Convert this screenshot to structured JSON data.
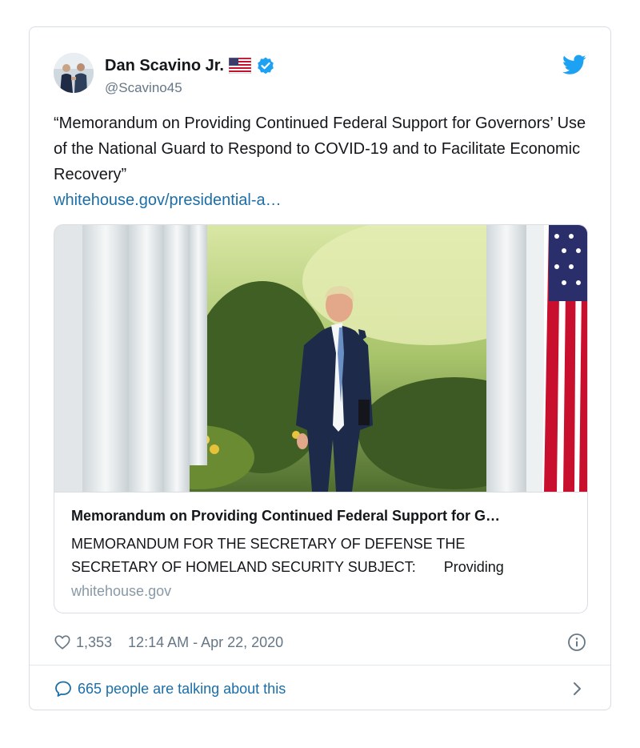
{
  "author": {
    "name": "Dan Scavino Jr.",
    "handle": "@Scavino45",
    "flag_icon": "us-flag-emoji",
    "verified_icon": "verified-badge-icon"
  },
  "tweet": {
    "text": "“Memorandum on Providing Continued Federal Support for Governors’ Use of the National Guard to Respond to COVID-19 and to Facilitate Economic Recovery”",
    "link": "whitehouse.gov/presidential-a…"
  },
  "link_card": {
    "title": "Memorandum on Providing Continued Federal Support for G…",
    "description": "MEMORANDUM FOR THE SECRETARY OF DEFENSE THE\nSECRETARY OF HOMELAND SECURITY SUBJECT:       Providing",
    "domain": "whitehouse.gov"
  },
  "stats": {
    "likes": "1,353",
    "timestamp": "12:14 AM - Apr 22, 2020"
  },
  "conversation": {
    "text": "665 people are talking about this"
  },
  "colors": {
    "accent": "#1da1f2",
    "link": "#1b6ea8",
    "muted": "#657786",
    "border": "#d8dee3"
  }
}
